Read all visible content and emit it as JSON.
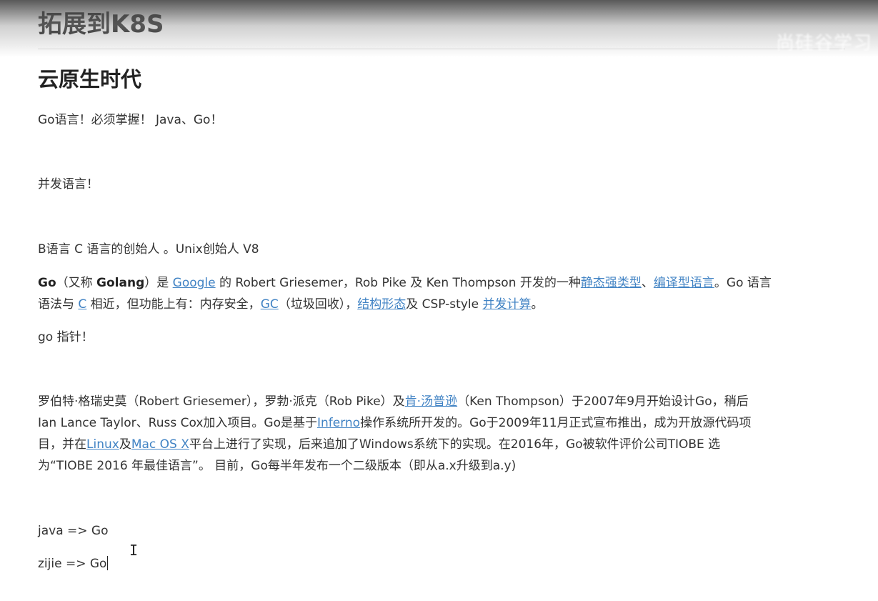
{
  "top_heading": "拓展到K8S",
  "watermark": "尚硅谷学习",
  "section_title": "云原生时代",
  "line1": "Go语言！必须掌握！ Java、Go！",
  "line2": "并发语言！",
  "line3": "B语言  C 语言的创始人 。Unix创始人  V8",
  "intro": {
    "go": "Go",
    "aka_prefix": "（又称 ",
    "golang": "Golang",
    "aka_suffix": "）是 ",
    "google": "Google",
    "t1": " 的 Robert Griesemer，Rob Pike 及 Ken Thompson 开发的一种",
    "static_typed": "静态强类型",
    "sep1": "、",
    "compiled": "编译型语言",
    "t2": "。Go 语言",
    "t3": "语法与 ",
    "c": "C",
    "t4": " 相近，但功能上有：内存安全，",
    "gc": "GC",
    "t5": "（垃圾回收），",
    "structural": "结构形态",
    "t6": "及 CSP-style ",
    "concurrency": "并发计算",
    "t7": "。"
  },
  "line_pointer": "go  指针！",
  "history": {
    "t1": "罗伯特·格瑞史莫（Robert Griesemer），罗勃·派克（Rob Pike）及",
    "ken": "肯·汤普逊",
    "t2": "（Ken Thompson）于2007年9月开始设计Go，稍后",
    "t3": "Ian Lance Taylor、Russ Cox加入项目。Go是基于",
    "inferno": "Inferno",
    "t4": "操作系统所开发的。Go于2009年11月正式宣布推出，成为开放源代码项",
    "t5": "目，并在",
    "linux": "Linux",
    "t6": "及",
    "macosx": "Mac OS X",
    "t7": "平台上进行了实现，后来追加了Windows系统下的实现。在2016年，Go被软件评价公司TIOBE 选",
    "t8": "为“TIOBE 2016 年最佳语言”。 目前，Go每半年发布一个二级版本（即从a.x升级到a.y)"
  },
  "java_line": "java => Go",
  "zijie_line": "zijie => Go",
  "colors": {
    "link": "#4183c4",
    "text": "#333333",
    "heading": "#222222"
  }
}
